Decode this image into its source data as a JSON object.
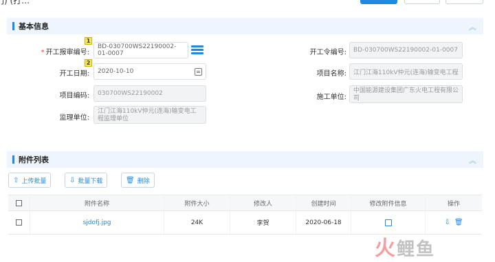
{
  "header": {
    "crumb": "门)  (打…"
  },
  "basic_section": {
    "title": "基本信息",
    "collapse_icon": "double-chevron-up-icon",
    "fields": {
      "report_no": {
        "label": "开工报审编号:",
        "value": "BD-030700WS22190002-01-0007",
        "required": true,
        "badge": "1"
      },
      "start_date": {
        "label": "开工日期:",
        "value": "2020-10-10",
        "badge": "2"
      },
      "project_code": {
        "label": "项目编码:",
        "value": "030700WS22190002"
      },
      "supervisor": {
        "label": "监理单位:",
        "value": "江门江海110kV仲元(连海)输变电工程监理单位"
      },
      "order_no": {
        "label": "开工令编号:",
        "value": "BD-030700WS22190002-01-0007"
      },
      "project_name": {
        "label": "项目名称:",
        "value": "江门江海110kV仲元(连海)输变电工程"
      },
      "contractor": {
        "label": "施工单位:",
        "value": "中国能源建设集团广东火电工程有限公司"
      }
    }
  },
  "attachment_section": {
    "title": "附件列表",
    "collapse_icon": "double-chevron-up-icon",
    "buttons": {
      "upload": "上传批量",
      "download": "批量下载",
      "delete": "删除"
    },
    "columns": [
      "附件名称",
      "附件大小",
      "修改人",
      "创建时间",
      "修改附件信息",
      "操作"
    ],
    "rows": [
      {
        "name": "sjdofj.jpg",
        "size": "24K",
        "modifier": "李贺",
        "created": "2020-06-18"
      }
    ]
  },
  "watermark": {
    "text1": "火",
    "text2": "鲤",
    "text3": "鱼"
  },
  "colors": {
    "accent": "#1e88e5",
    "section_bg": "#eef5fc",
    "required": "#e53935"
  }
}
